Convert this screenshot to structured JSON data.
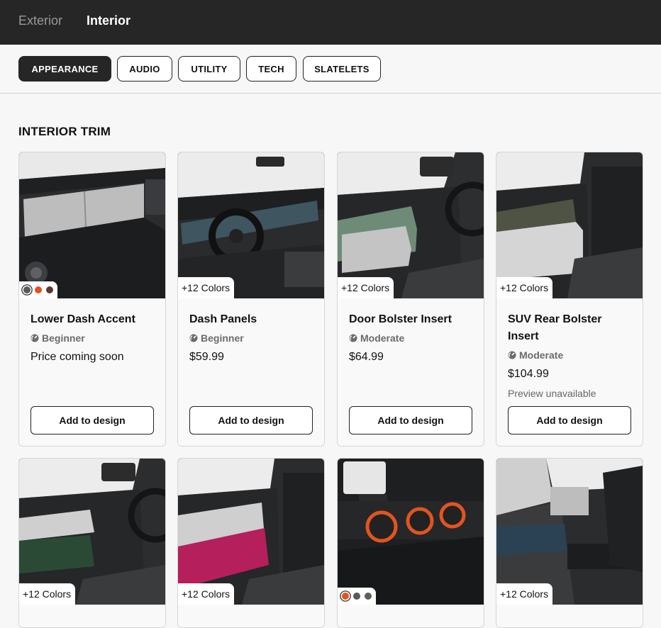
{
  "header": {
    "tabs": [
      {
        "label": "Exterior",
        "active": false
      },
      {
        "label": "Interior",
        "active": true
      }
    ]
  },
  "filters": [
    {
      "label": "APPEARANCE",
      "active": true
    },
    {
      "label": "AUDIO",
      "active": false
    },
    {
      "label": "UTILITY",
      "active": false
    },
    {
      "label": "TECH",
      "active": false
    },
    {
      "label": "SLATELETS",
      "active": false
    }
  ],
  "section": {
    "title": "INTERIOR TRIM"
  },
  "cards": [
    {
      "name": "Lower Dash Accent",
      "difficulty": "Beginner",
      "price": "Price coming soon",
      "preview": "",
      "button": "Add to design",
      "colors_label": "",
      "swatches": [
        "#5a5a5a",
        "#e2541f",
        "#5a3b30"
      ]
    },
    {
      "name": "Dash Panels",
      "difficulty": "Beginner",
      "price": "$59.99",
      "preview": "",
      "button": "Add to design",
      "colors_label": "+12 Colors",
      "swatches": []
    },
    {
      "name": "Door Bolster Insert",
      "difficulty": "Moderate",
      "price": "$64.99",
      "preview": "",
      "button": "Add to design",
      "colors_label": "+12 Colors",
      "swatches": []
    },
    {
      "name": "SUV Rear Bolster Insert",
      "difficulty": "Moderate",
      "price": "$104.99",
      "preview": "Preview unavailable",
      "button": "Add to design",
      "colors_label": "+12 Colors",
      "swatches": []
    },
    {
      "name": "",
      "difficulty": "",
      "price": "",
      "preview": "",
      "button": "",
      "colors_label": "+12 Colors",
      "swatches": []
    },
    {
      "name": "",
      "difficulty": "",
      "price": "",
      "preview": "",
      "button": "",
      "colors_label": "+12 Colors",
      "swatches": []
    },
    {
      "name": "",
      "difficulty": "",
      "price": "",
      "preview": "",
      "button": "",
      "colors_label": "",
      "swatches": [
        "#e2541f",
        "#5a5a5a",
        "#5b6158"
      ]
    },
    {
      "name": "",
      "difficulty": "",
      "price": "",
      "preview": "",
      "button": "",
      "colors_label": "+12 Colors",
      "swatches": []
    }
  ],
  "colors": {
    "dark": "#262626",
    "accent_orange": "#e2541f"
  }
}
